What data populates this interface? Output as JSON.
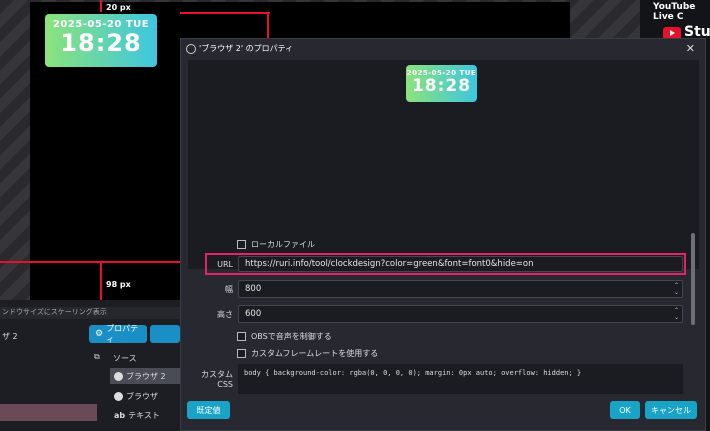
{
  "stage": {
    "guide_top": "20 px",
    "guide_bottom": "98 px",
    "clock_date": "2025-05-20 TUE",
    "clock_time": "18:28",
    "status_text": "ンドウサイズにスケーリング表示",
    "scene_name": "ザ 2",
    "properties_button": "プロパティ",
    "sources_header": "ソース",
    "sources": [
      "ブラウザ 2",
      "ブラウザ",
      "テキスト"
    ]
  },
  "sidebar": {
    "title": "YouTube Live C",
    "brand": "Stud"
  },
  "dialog": {
    "title": "'ブラウザ 2' のプロパティ",
    "close": "✕",
    "preview_date": "2025-05-20 TUE",
    "preview_time": "18:28",
    "local_file_label": "ローカルファイル",
    "url_label": "URL",
    "url_value": "https://ruri.info/tool/clockdesign?color=green&font=font0&hide=on",
    "width_label": "幅",
    "width_value": "800",
    "height_label": "高さ",
    "height_value": "600",
    "audio_label": "OBSで音声を制御する",
    "framerate_label": "カスタムフレームレートを使用する",
    "css_label": "カスタム CSS",
    "css_value": "body { background-color: rgba(0, 0, 0, 0); margin: 0px auto; overflow: hidden; }",
    "defaults_button": "既定値",
    "ok_button": "OK",
    "cancel_button": "キャンセル"
  }
}
